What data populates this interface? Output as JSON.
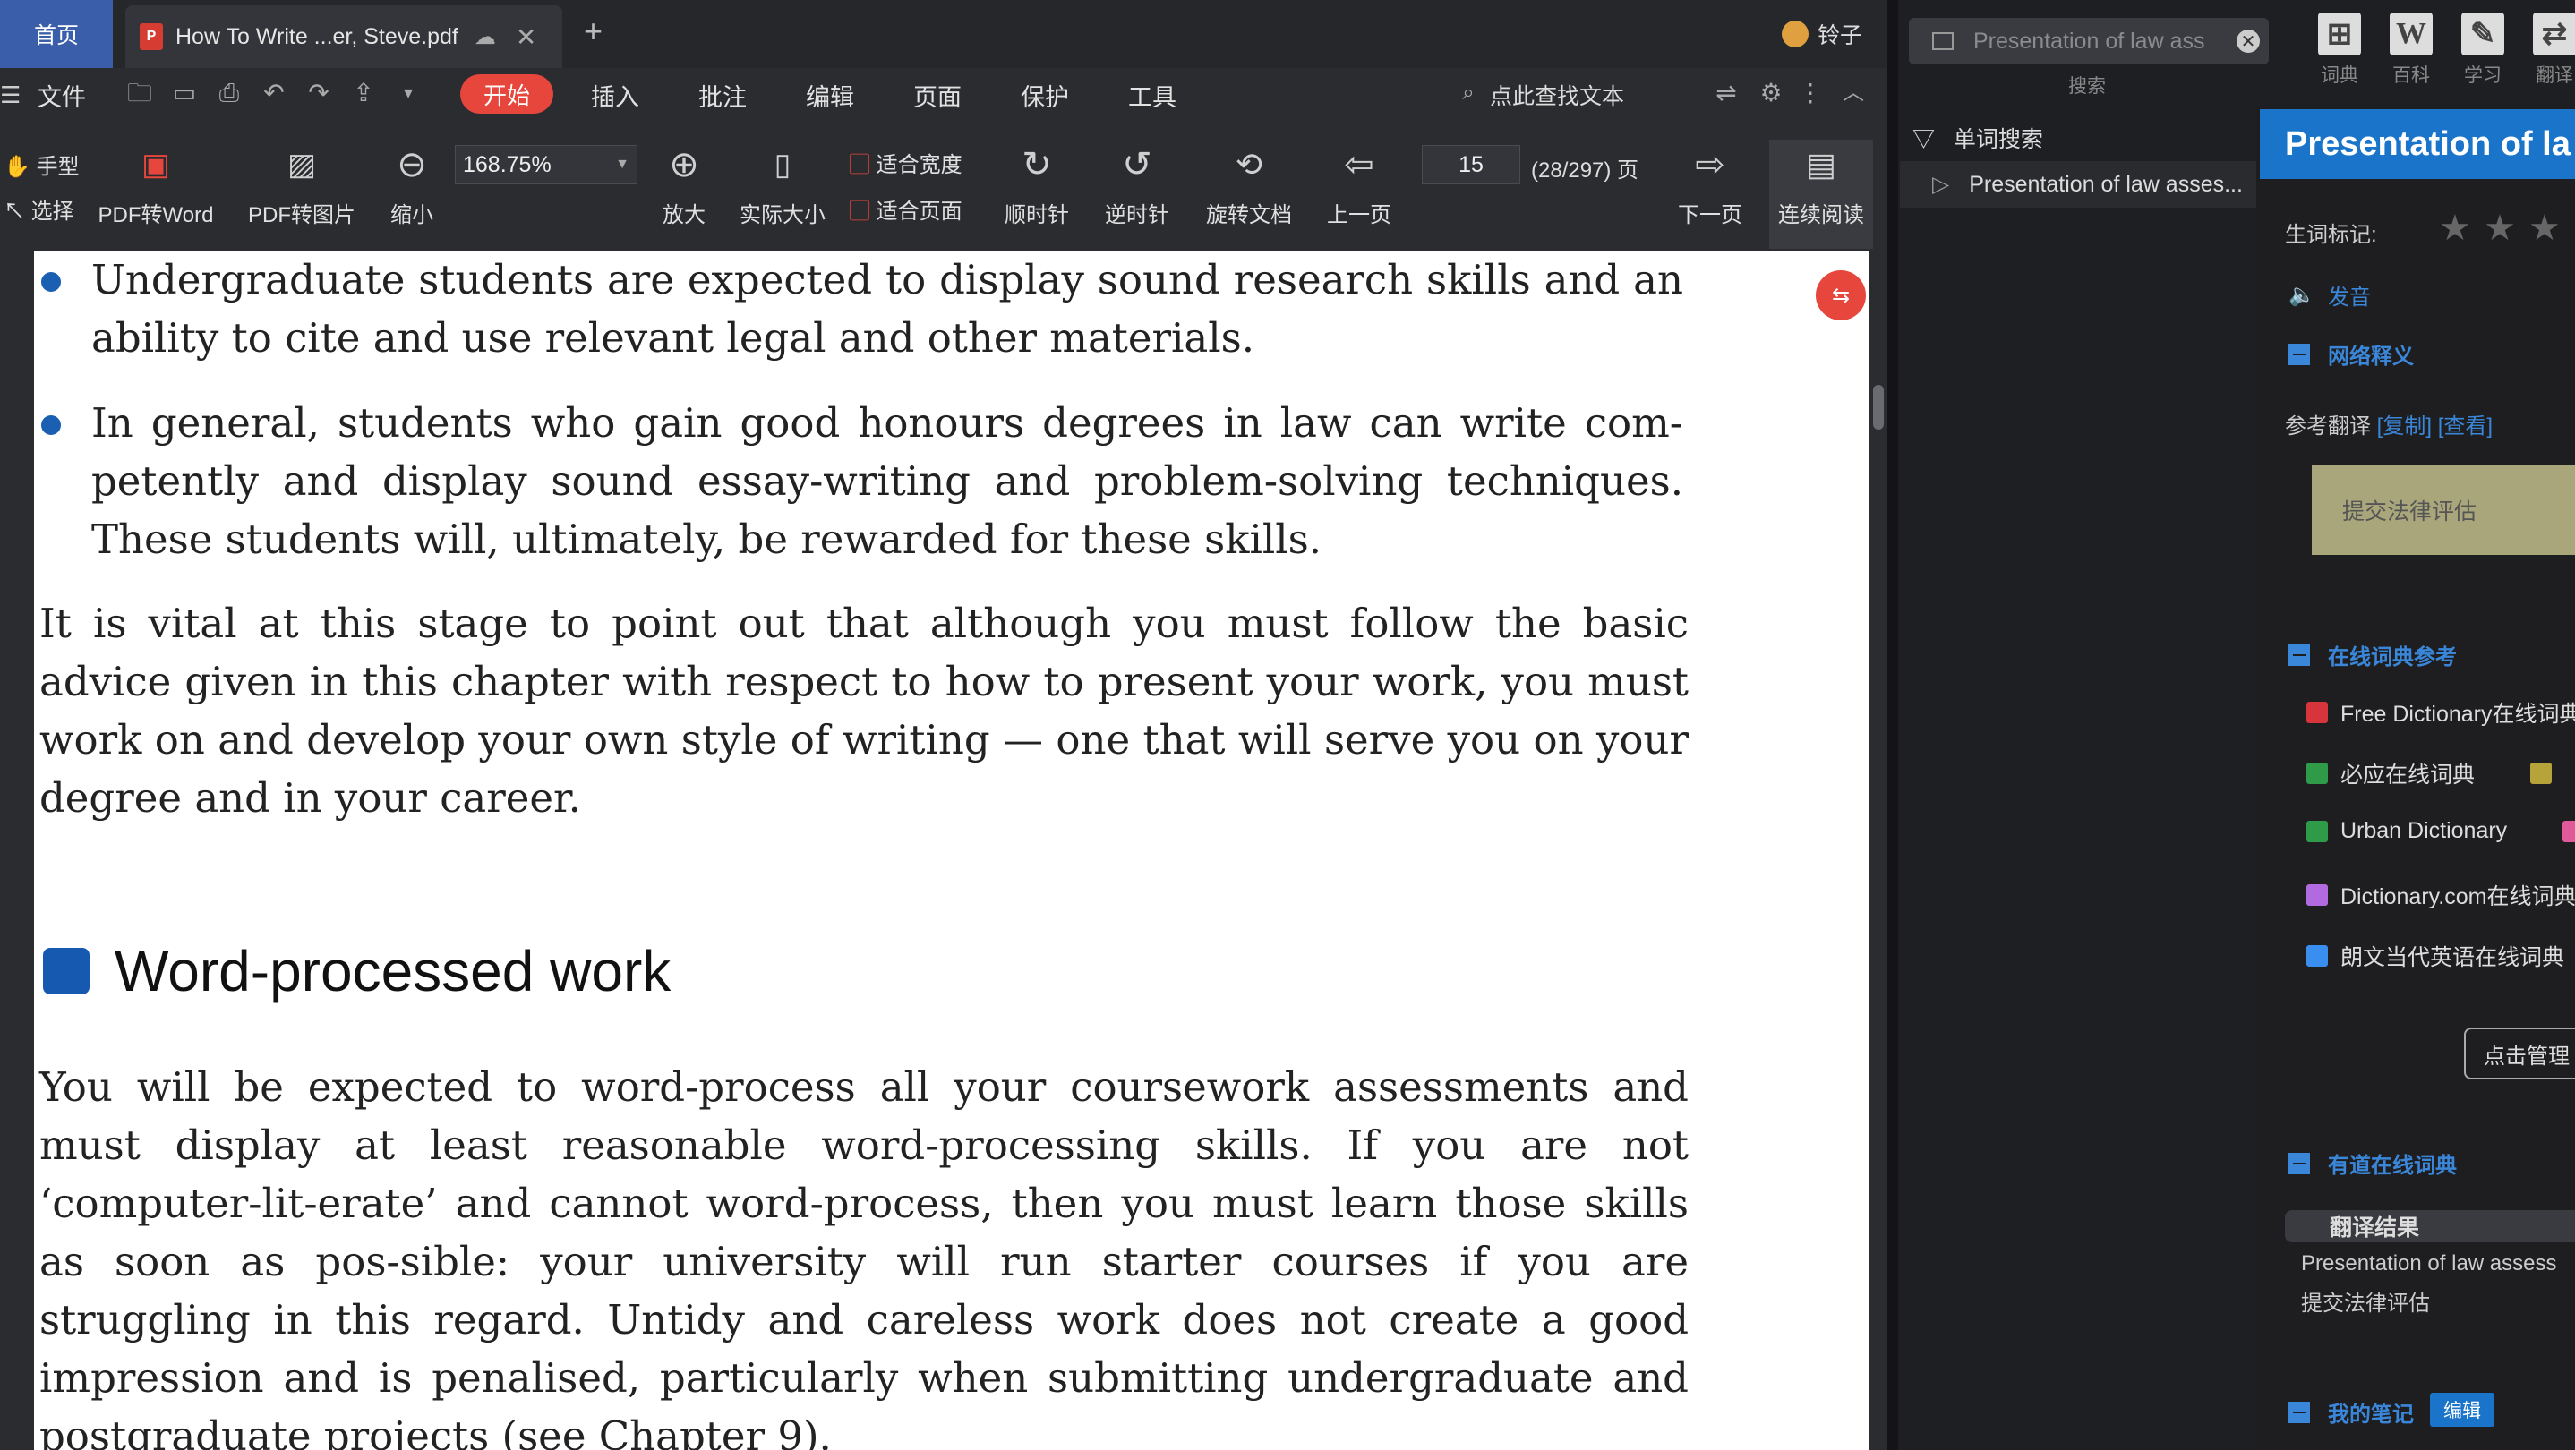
{
  "tabs": {
    "home": "首页",
    "document": "How To Write ...er, Steve.pdf",
    "user_name": "铃子"
  },
  "menu": {
    "file": "文件",
    "start": "开始",
    "insert": "插入",
    "annotate": "批注",
    "edit": "编辑",
    "page": "页面",
    "protect": "保护",
    "tools": "工具",
    "find_text": "点此查找文本"
  },
  "toolbar": {
    "hand": "手型",
    "select": "选择",
    "pdf_to_word": "PDF转Word",
    "pdf_to_image": "PDF转图片",
    "zoom_out": "缩小",
    "zoom_value": "168.75%",
    "zoom_in": "放大",
    "actual_size": "实际大小",
    "fit_width": "适合宽度",
    "fit_page": "适合页面",
    "clockwise": "顺时针",
    "counter_clockwise": "逆时针",
    "rotate_doc": "旋转文档",
    "prev_page": "上一页",
    "page_number": "15",
    "page_total": "(28/297) 页",
    "next_page": "下一页",
    "continuous": "连续阅读"
  },
  "document": {
    "bullets": [
      "Undergraduate students are expected to display sound research skills and an ability to cite and use relevant legal and other materials.",
      "In general, students who gain good honours degrees in law can write com-petently and display sound essay-writing and problem-solving techniques. These students will, ultimately, be rewarded for these skills."
    ],
    "paragraph1": "It is vital at this stage to point out that although you must follow the basic advice given in this chapter with respect to how to present your work, you must work on and develop your own style of writing — one that will serve you on your degree and in your career.",
    "heading": "Word-processed work",
    "paragraph2": "You will be expected to word-process all your coursework assessments and must display at least reasonable word-processing skills. If you are not ‘computer-lit-erate’ and cannot word-process, then you must learn those skills as soon as pos-sible: your university will run starter courses if you are struggling in this regard. Untidy and careless work does not create a good impression and is penalised, particularly when submitting undergraduate and postgraduate projects (see Chapter 9)."
  },
  "dictionary": {
    "search_value": "Presentation of law ass",
    "search_label": "搜索",
    "tools": [
      "词典",
      "百科",
      "学习",
      "翻译"
    ],
    "word_search_title": "单词搜索",
    "word_search_item": "Presentation of law asses...",
    "entry_title": "Presentation of la",
    "vocab_mark": "生词标记:",
    "pronounce": "发音",
    "web_def": "网络释义",
    "ref_trans_label": "参考翻译",
    "copy": "[复制]",
    "view": "[查看]",
    "translation": "提交法律评估",
    "online_ref": "在线词典参考",
    "dicts": [
      {
        "name": "Free Dictionary在线词典",
        "color": "#d8343c"
      },
      {
        "name": "必应在线词典",
        "color": "#2f9a48"
      },
      {
        "name": "Urban Dictionary",
        "color": "#2f9a48"
      },
      {
        "name": "Dictionary.com在线词典",
        "color": "#b26ae0"
      },
      {
        "name": "朗文当代英语在线词典",
        "color": "#3a8ef0"
      }
    ],
    "manage": "点击管理",
    "youdao": "有道在线词典",
    "result_head": "翻译结果",
    "result_en": "Presentation of law assess",
    "result_zh": "提交法律评估",
    "my_notes": "我的笔记",
    "edit": "编辑"
  }
}
